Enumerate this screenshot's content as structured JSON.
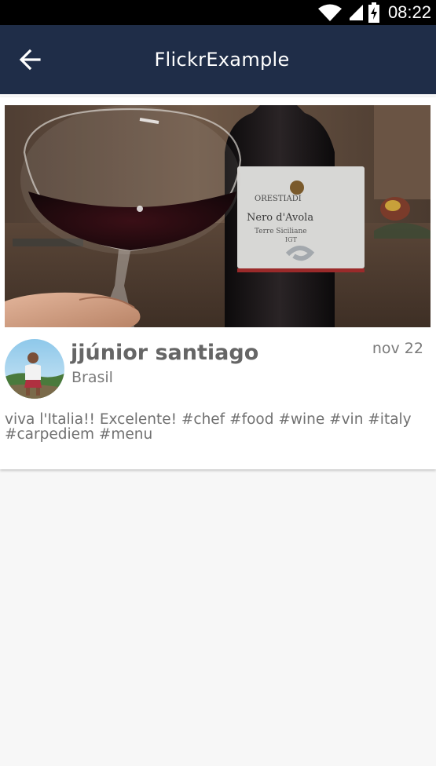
{
  "status_bar": {
    "time": "08:22",
    "icons": [
      "wifi-icon",
      "signal-icon",
      "battery-charging-icon"
    ]
  },
  "app_bar": {
    "title": "FlickrExample",
    "back_icon": "arrow-back-icon"
  },
  "post": {
    "user_name": "jjúnior santiago",
    "location": "Brasil",
    "date": "nov 22",
    "caption": "viva l'Italia!! Excelente! #chef #food #wine #vin #italy #carpediem #menu",
    "label_lines": [
      "ORESTIADI",
      "Nero d'Avola",
      "Terre Siciliane",
      "IGT"
    ]
  },
  "colors": {
    "app_bar": "#1f2d48",
    "status_bar": "#000000",
    "background": "#f7f7f7"
  }
}
